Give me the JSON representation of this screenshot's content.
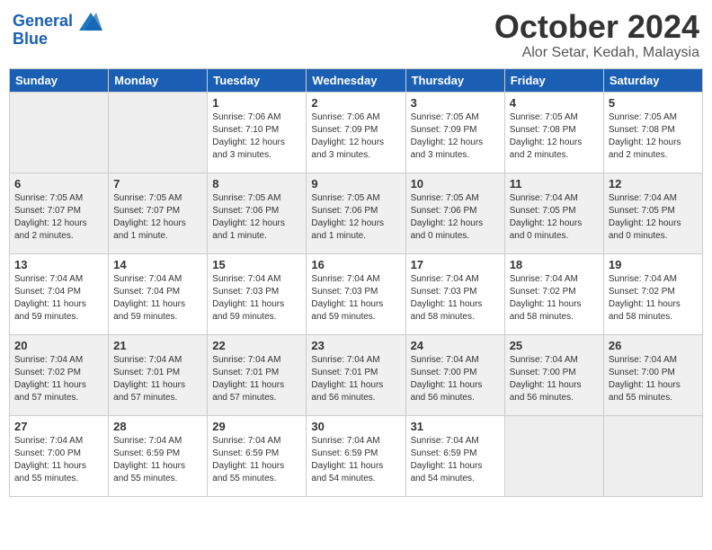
{
  "header": {
    "logo_line1": "General",
    "logo_line2": "Blue",
    "month": "October 2024",
    "location": "Alor Setar, Kedah, Malaysia"
  },
  "weekdays": [
    "Sunday",
    "Monday",
    "Tuesday",
    "Wednesday",
    "Thursday",
    "Friday",
    "Saturday"
  ],
  "weeks": [
    [
      {
        "day": "",
        "info": ""
      },
      {
        "day": "",
        "info": ""
      },
      {
        "day": "1",
        "info": "Sunrise: 7:06 AM\nSunset: 7:10 PM\nDaylight: 12 hours\nand 3 minutes."
      },
      {
        "day": "2",
        "info": "Sunrise: 7:06 AM\nSunset: 7:09 PM\nDaylight: 12 hours\nand 3 minutes."
      },
      {
        "day": "3",
        "info": "Sunrise: 7:05 AM\nSunset: 7:09 PM\nDaylight: 12 hours\nand 3 minutes."
      },
      {
        "day": "4",
        "info": "Sunrise: 7:05 AM\nSunset: 7:08 PM\nDaylight: 12 hours\nand 2 minutes."
      },
      {
        "day": "5",
        "info": "Sunrise: 7:05 AM\nSunset: 7:08 PM\nDaylight: 12 hours\nand 2 minutes."
      }
    ],
    [
      {
        "day": "6",
        "info": "Sunrise: 7:05 AM\nSunset: 7:07 PM\nDaylight: 12 hours\nand 2 minutes."
      },
      {
        "day": "7",
        "info": "Sunrise: 7:05 AM\nSunset: 7:07 PM\nDaylight: 12 hours\nand 1 minute."
      },
      {
        "day": "8",
        "info": "Sunrise: 7:05 AM\nSunset: 7:06 PM\nDaylight: 12 hours\nand 1 minute."
      },
      {
        "day": "9",
        "info": "Sunrise: 7:05 AM\nSunset: 7:06 PM\nDaylight: 12 hours\nand 1 minute."
      },
      {
        "day": "10",
        "info": "Sunrise: 7:05 AM\nSunset: 7:06 PM\nDaylight: 12 hours\nand 0 minutes."
      },
      {
        "day": "11",
        "info": "Sunrise: 7:04 AM\nSunset: 7:05 PM\nDaylight: 12 hours\nand 0 minutes."
      },
      {
        "day": "12",
        "info": "Sunrise: 7:04 AM\nSunset: 7:05 PM\nDaylight: 12 hours\nand 0 minutes."
      }
    ],
    [
      {
        "day": "13",
        "info": "Sunrise: 7:04 AM\nSunset: 7:04 PM\nDaylight: 11 hours\nand 59 minutes."
      },
      {
        "day": "14",
        "info": "Sunrise: 7:04 AM\nSunset: 7:04 PM\nDaylight: 11 hours\nand 59 minutes."
      },
      {
        "day": "15",
        "info": "Sunrise: 7:04 AM\nSunset: 7:03 PM\nDaylight: 11 hours\nand 59 minutes."
      },
      {
        "day": "16",
        "info": "Sunrise: 7:04 AM\nSunset: 7:03 PM\nDaylight: 11 hours\nand 59 minutes."
      },
      {
        "day": "17",
        "info": "Sunrise: 7:04 AM\nSunset: 7:03 PM\nDaylight: 11 hours\nand 58 minutes."
      },
      {
        "day": "18",
        "info": "Sunrise: 7:04 AM\nSunset: 7:02 PM\nDaylight: 11 hours\nand 58 minutes."
      },
      {
        "day": "19",
        "info": "Sunrise: 7:04 AM\nSunset: 7:02 PM\nDaylight: 11 hours\nand 58 minutes."
      }
    ],
    [
      {
        "day": "20",
        "info": "Sunrise: 7:04 AM\nSunset: 7:02 PM\nDaylight: 11 hours\nand 57 minutes."
      },
      {
        "day": "21",
        "info": "Sunrise: 7:04 AM\nSunset: 7:01 PM\nDaylight: 11 hours\nand 57 minutes."
      },
      {
        "day": "22",
        "info": "Sunrise: 7:04 AM\nSunset: 7:01 PM\nDaylight: 11 hours\nand 57 minutes."
      },
      {
        "day": "23",
        "info": "Sunrise: 7:04 AM\nSunset: 7:01 PM\nDaylight: 11 hours\nand 56 minutes."
      },
      {
        "day": "24",
        "info": "Sunrise: 7:04 AM\nSunset: 7:00 PM\nDaylight: 11 hours\nand 56 minutes."
      },
      {
        "day": "25",
        "info": "Sunrise: 7:04 AM\nSunset: 7:00 PM\nDaylight: 11 hours\nand 56 minutes."
      },
      {
        "day": "26",
        "info": "Sunrise: 7:04 AM\nSunset: 7:00 PM\nDaylight: 11 hours\nand 55 minutes."
      }
    ],
    [
      {
        "day": "27",
        "info": "Sunrise: 7:04 AM\nSunset: 7:00 PM\nDaylight: 11 hours\nand 55 minutes."
      },
      {
        "day": "28",
        "info": "Sunrise: 7:04 AM\nSunset: 6:59 PM\nDaylight: 11 hours\nand 55 minutes."
      },
      {
        "day": "29",
        "info": "Sunrise: 7:04 AM\nSunset: 6:59 PM\nDaylight: 11 hours\nand 55 minutes."
      },
      {
        "day": "30",
        "info": "Sunrise: 7:04 AM\nSunset: 6:59 PM\nDaylight: 11 hours\nand 54 minutes."
      },
      {
        "day": "31",
        "info": "Sunrise: 7:04 AM\nSunset: 6:59 PM\nDaylight: 11 hours\nand 54 minutes."
      },
      {
        "day": "",
        "info": ""
      },
      {
        "day": "",
        "info": ""
      }
    ]
  ]
}
